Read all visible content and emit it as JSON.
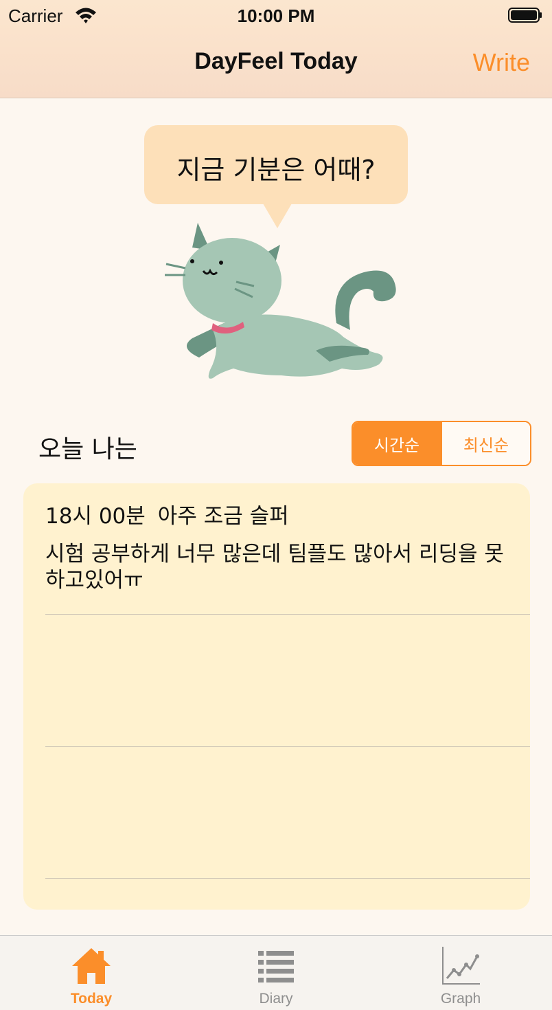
{
  "status_bar": {
    "carrier": "Carrier",
    "time": "10:00 PM"
  },
  "nav": {
    "title": "DayFeel Today",
    "write_label": "Write"
  },
  "bubble": {
    "text": "지금 기분은 어때?"
  },
  "section": {
    "label": "오늘 나는"
  },
  "sort": {
    "options": [
      "시간순",
      "최신순"
    ],
    "selected": "시간순"
  },
  "entries": [
    {
      "time": "18시 00분",
      "mood": "아주 조금 슬퍼",
      "text": "시험 공부하게 너무 많은데 팀플도 많아서 리딩을 못하고있어ㅠ"
    }
  ],
  "tabs": [
    {
      "label": "Today",
      "icon": "home-icon",
      "active": true
    },
    {
      "label": "Diary",
      "icon": "list-icon",
      "active": false
    },
    {
      "label": "Graph",
      "icon": "graph-icon",
      "active": false
    }
  ],
  "colors": {
    "accent": "#fb8e2a",
    "background": "#fdf7f0",
    "card": "#fff2cf",
    "bubble": "#fde0b9",
    "inactive": "#8e8e8e"
  }
}
